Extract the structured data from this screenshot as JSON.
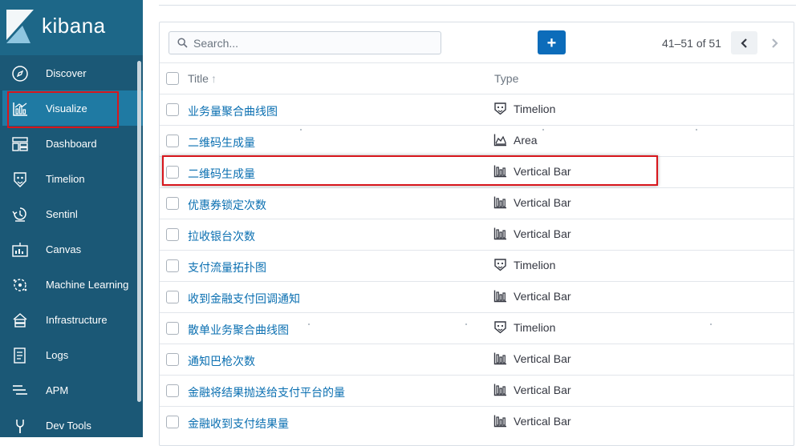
{
  "app": {
    "brand": "kibana"
  },
  "sidebar": {
    "items": [
      {
        "label": "Discover",
        "icon": "compass-icon",
        "active": false
      },
      {
        "label": "Visualize",
        "icon": "visualize-chart-icon",
        "active": true
      },
      {
        "label": "Dashboard",
        "icon": "dashboard-icon",
        "active": false
      },
      {
        "label": "Timelion",
        "icon": "timelion-icon",
        "active": false
      },
      {
        "label": "Sentinl",
        "icon": "sentinl-icon",
        "active": false
      },
      {
        "label": "Canvas",
        "icon": "canvas-icon",
        "active": false
      },
      {
        "label": "Machine Learning",
        "icon": "machine-learning-icon",
        "active": false
      },
      {
        "label": "Infrastructure",
        "icon": "infrastructure-icon",
        "active": false
      },
      {
        "label": "Logs",
        "icon": "logs-icon",
        "active": false
      },
      {
        "label": "APM",
        "icon": "apm-icon",
        "active": false
      },
      {
        "label": "Dev Tools",
        "icon": "wrench-icon",
        "active": false
      }
    ]
  },
  "toolbar": {
    "search_placeholder": "Search...",
    "add_label": "+",
    "pagination": "41–51 of 51"
  },
  "table": {
    "columns": {
      "title": "Title",
      "type": "Type"
    },
    "rows": [
      {
        "title": "业务量聚合曲线图",
        "type": "Timelion",
        "icon": "timelion-icon"
      },
      {
        "title": "二维码生成量",
        "type": "Area",
        "icon": "area-chart-icon"
      },
      {
        "title": "二维码生成量",
        "type": "Vertical Bar",
        "icon": "vertical-bar-icon"
      },
      {
        "title": "优惠券锁定次数",
        "type": "Vertical Bar",
        "icon": "vertical-bar-icon"
      },
      {
        "title": "拉收银台次数",
        "type": "Vertical Bar",
        "icon": "vertical-bar-icon"
      },
      {
        "title": "支付流量拓扑图",
        "type": "Timelion",
        "icon": "timelion-icon"
      },
      {
        "title": "收到金融支付回调通知",
        "type": "Vertical Bar",
        "icon": "vertical-bar-icon"
      },
      {
        "title": "散单业务聚合曲线图",
        "type": "Timelion",
        "icon": "timelion-icon"
      },
      {
        "title": "通知巴枪次数",
        "type": "Vertical Bar",
        "icon": "vertical-bar-icon"
      },
      {
        "title": "金融将结果抛送给支付平台的量",
        "type": "Vertical Bar",
        "icon": "vertical-bar-icon"
      },
      {
        "title": "金融收到支付结果量",
        "type": "Vertical Bar",
        "icon": "vertical-bar-icon"
      }
    ]
  },
  "colors": {
    "sidebar_bg": "#1b5876",
    "sidebar_active": "#1f7aa3",
    "accent_button": "#0c6cba",
    "link": "#0a6fb1",
    "highlight": "#d8161c"
  }
}
